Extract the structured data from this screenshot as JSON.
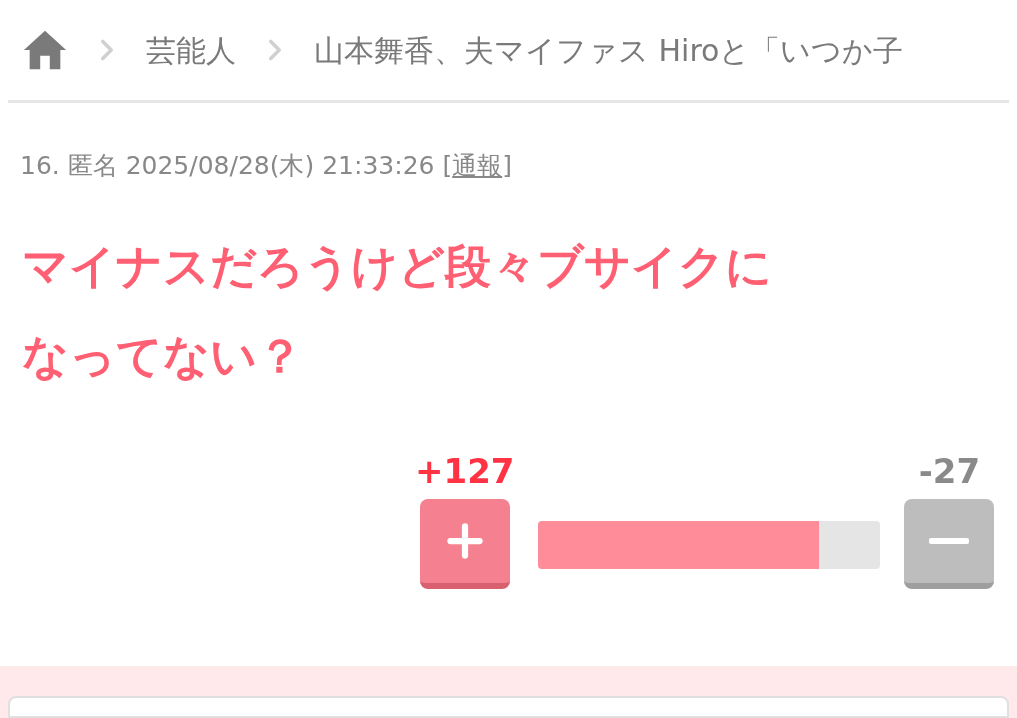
{
  "breadcrumb": {
    "items": [
      "芸能人",
      "山本舞香、夫マイファス Hiroと「いつか子"
    ]
  },
  "comment": {
    "meta": {
      "text": "16. 匿名 2025/08/28(木) 21:33:26 ",
      "report_open": "[",
      "report": "通報",
      "report_close": "]"
    },
    "body_lines": [
      "マイナスだろうけど段々ブサイクに",
      "なってない？"
    ],
    "votes": {
      "plus": "+127",
      "minus": "-27",
      "level": 0.82
    }
  }
}
